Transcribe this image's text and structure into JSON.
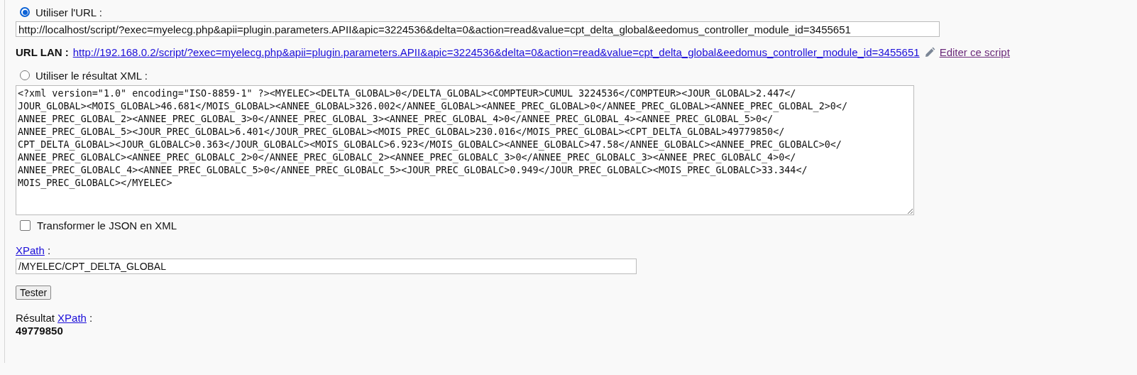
{
  "source_options": [
    {
      "label": "Utiliser l'URL :",
      "selected": true
    },
    {
      "label": "Utiliser le résultat XML :",
      "selected": false
    }
  ],
  "url_field": {
    "value": "http://localhost/script/?exec=myelecg.php&apii=plugin.parameters.APII&apic=3224536&delta=0&action=read&value=cpt_delta_global&eedomus_controller_module_id=3455651"
  },
  "url_lan": {
    "label": "URL LAN :",
    "link": "http://192.168.0.2/script/?exec=myelecg.php&apii=plugin.parameters.APII&apic=3224536&delta=0&action=read&value=cpt_delta_global&eedomus_controller_module_id=3455651",
    "edit_link": "Editer ce script"
  },
  "xml_result": {
    "lines": [
      "<?xml version=\"1.0\" encoding=\"ISO-8859-1\" ?><MYELEC><DELTA_GLOBAL>0</DELTA_GLOBAL><COMPTEUR>CUMUL 3224536</COMPTEUR><JOUR_GLOBAL>2.447</",
      "JOUR_GLOBAL><MOIS_GLOBAL>46.681</MOIS_GLOBAL><ANNEE_GLOBAL>326.002</ANNEE_GLOBAL><ANNEE_PREC_GLOBAL>0</ANNEE_PREC_GLOBAL><ANNEE_PREC_GLOBAL_2>0</",
      "ANNEE_PREC_GLOBAL_2><ANNEE_PREC_GLOBAL_3>0</ANNEE_PREC_GLOBAL_3><ANNEE_PREC_GLOBAL_4>0</ANNEE_PREC_GLOBAL_4><ANNEE_PREC_GLOBAL_5>0</",
      "ANNEE_PREC_GLOBAL_5><JOUR_PREC_GLOBAL>6.401</JOUR_PREC_GLOBAL><MOIS_PREC_GLOBAL>230.016</MOIS_PREC_GLOBAL><CPT_DELTA_GLOBAL>49779850</",
      "CPT_DELTA_GLOBAL><JOUR_GLOBALC>0.363</JOUR_GLOBALC><MOIS_GLOBALC>6.923</MOIS_GLOBALC><ANNEE_GLOBALC>47.58</ANNEE_GLOBALC><ANNEE_PREC_GLOBALC>0</",
      "ANNEE_PREC_GLOBALC><ANNEE_PREC_GLOBALC_2>0</ANNEE_PREC_GLOBALC_2><ANNEE_PREC_GLOBALC_3>0</ANNEE_PREC_GLOBALC_3><ANNEE_PREC_GLOBALC_4>0</",
      "ANNEE_PREC_GLOBALC_4><ANNEE_PREC_GLOBALC_5>0</ANNEE_PREC_GLOBALC_5><JOUR_PREC_GLOBALC>0.949</JOUR_PREC_GLOBALC><MOIS_PREC_GLOBALC>33.344</",
      "MOIS_PREC_GLOBALC></MYELEC>"
    ]
  },
  "transform_json": {
    "label": "Transformer le JSON en XML",
    "checked": false
  },
  "xpath": {
    "link": "XPath",
    "suffix": ":",
    "value": "/MYELEC/CPT_DELTA_GLOBAL"
  },
  "test_button": "Tester",
  "result": {
    "label": "Résultat",
    "link": "XPath",
    "suffix": ":",
    "value": "49779850"
  }
}
